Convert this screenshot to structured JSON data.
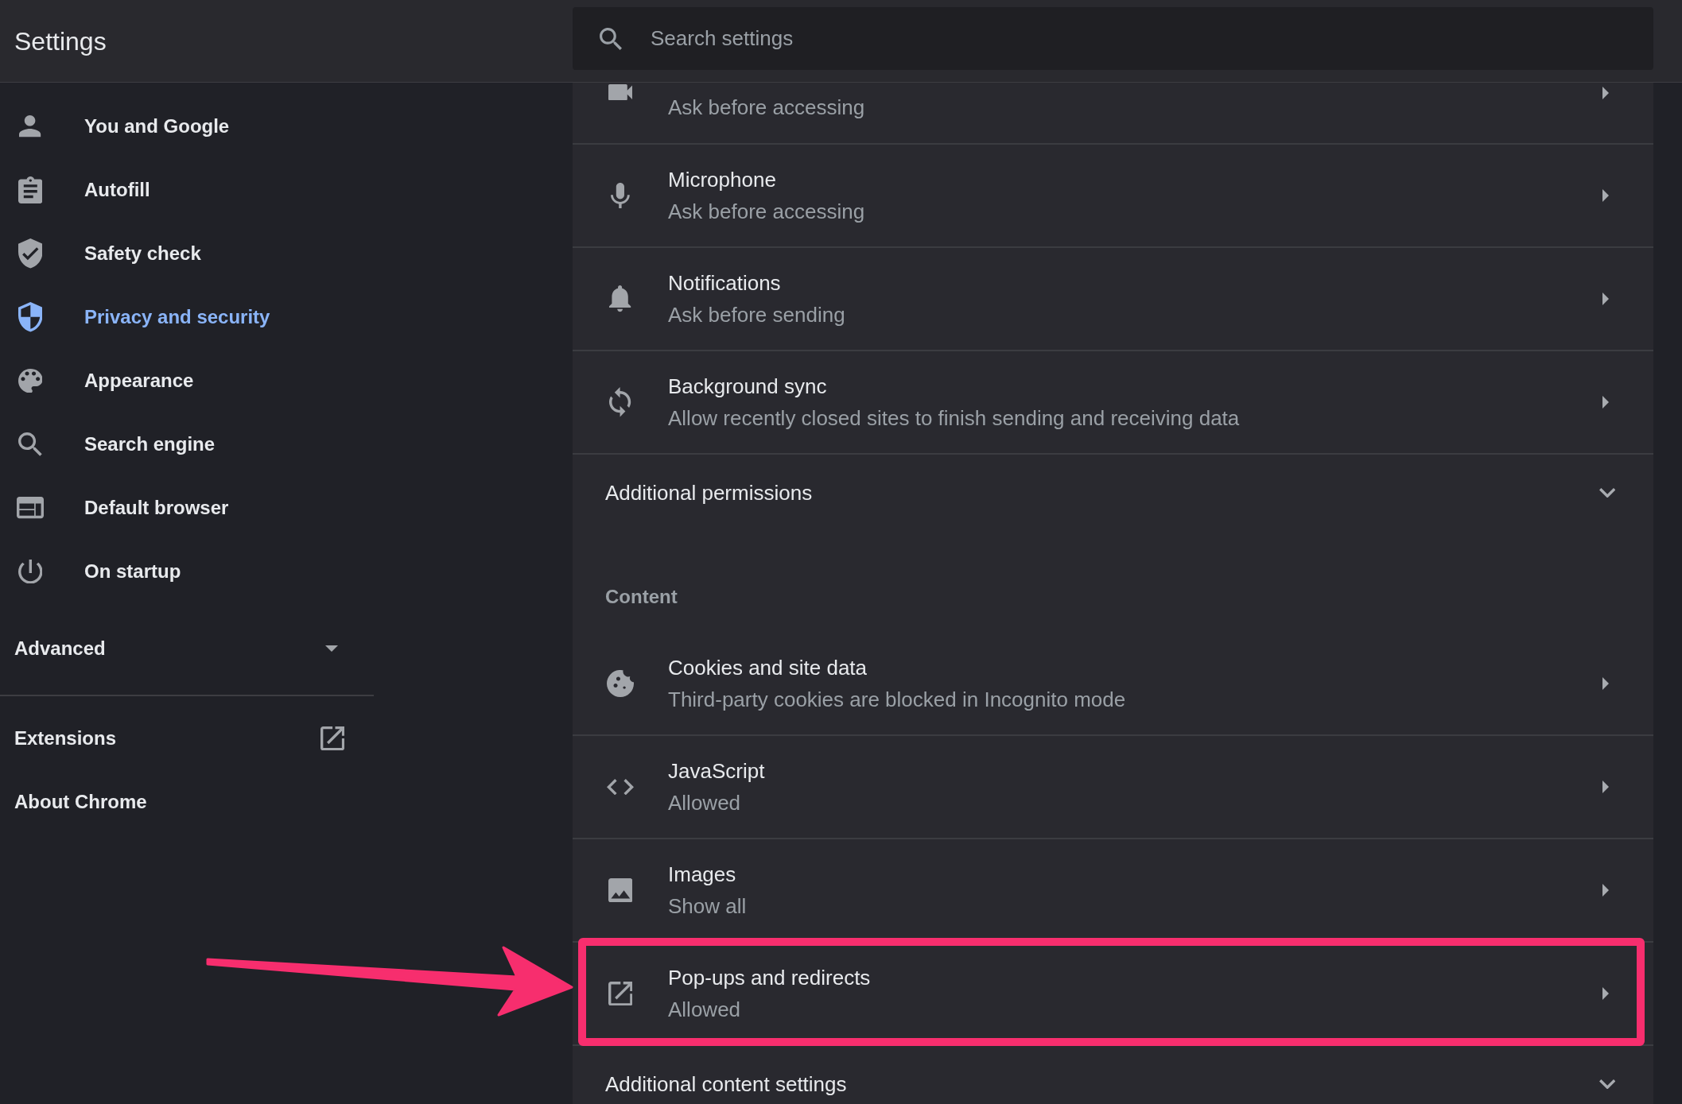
{
  "header": {
    "title": "Settings",
    "search": {
      "placeholder": "Search settings"
    }
  },
  "sidebar": {
    "items": [
      {
        "label": "You and Google",
        "selected": false
      },
      {
        "label": "Autofill",
        "selected": false
      },
      {
        "label": "Safety check",
        "selected": false
      },
      {
        "label": "Privacy and security",
        "selected": true
      },
      {
        "label": "Appearance",
        "selected": false
      },
      {
        "label": "Search engine",
        "selected": false
      },
      {
        "label": "Default browser",
        "selected": false
      },
      {
        "label": "On startup",
        "selected": false
      }
    ],
    "advanced": {
      "label": "Advanced",
      "expanded": false
    },
    "links": [
      {
        "label": "Extensions",
        "kind": "external"
      },
      {
        "label": "About Chrome",
        "kind": "internal"
      }
    ]
  },
  "content": {
    "rows": [
      {
        "kind": "setting",
        "subtitle": "Ask before accessing",
        "highlighted": false
      },
      {
        "kind": "setting",
        "title": "Microphone",
        "subtitle": "Ask before accessing",
        "highlighted": false
      },
      {
        "kind": "setting",
        "title": "Notifications",
        "subtitle": "Ask before sending",
        "highlighted": false
      },
      {
        "kind": "setting",
        "title": "Background sync",
        "subtitle": "Allow recently closed sites to finish sending and receiving data",
        "highlighted": false
      },
      {
        "kind": "expander",
        "label": "Additional permissions",
        "expanded": false
      },
      {
        "kind": "heading",
        "label": "Content"
      },
      {
        "kind": "setting",
        "title": "Cookies and site data",
        "subtitle": "Third-party cookies are blocked in Incognito mode",
        "highlighted": false
      },
      {
        "kind": "setting",
        "title": "JavaScript",
        "subtitle": "Allowed",
        "highlighted": false
      },
      {
        "kind": "setting",
        "title": "Images",
        "subtitle": "Show all",
        "highlighted": false
      },
      {
        "kind": "setting",
        "title": "Pop-ups and redirects",
        "subtitle": "Allowed",
        "highlighted": true
      },
      {
        "kind": "expander",
        "label": "Additional content settings",
        "expanded": false
      }
    ]
  }
}
